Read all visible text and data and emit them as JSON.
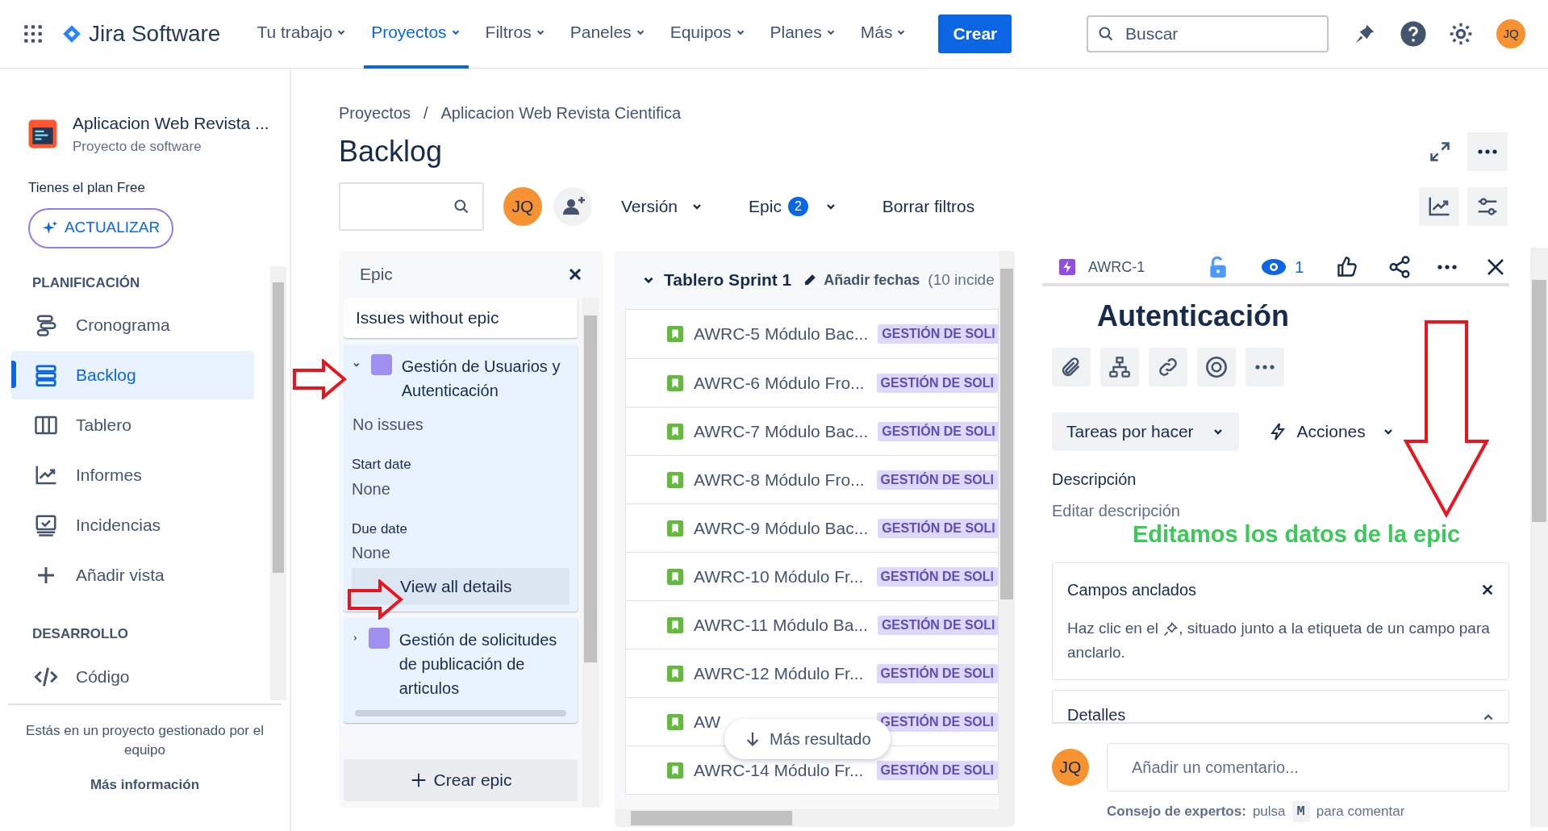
{
  "nav": {
    "logo": "Jira Software",
    "menu": [
      {
        "label": "Tu trabajo",
        "selected": false
      },
      {
        "label": "Proyectos",
        "selected": true
      },
      {
        "label": "Filtros",
        "selected": false
      },
      {
        "label": "Paneles",
        "selected": false
      },
      {
        "label": "Equipos",
        "selected": false
      },
      {
        "label": "Planes",
        "selected": false
      },
      {
        "label": "Más",
        "selected": false
      }
    ],
    "create": "Crear",
    "search": {
      "placeholder": "Buscar"
    },
    "avatar": "JQ"
  },
  "sidebar": {
    "project": {
      "name": "Aplicacion Web Revista ...",
      "type": "Proyecto de software"
    },
    "plan": "Tienes el plan Free",
    "upgrade": "ACTUALIZAR",
    "sections": [
      {
        "title": "PLANIFICACIÓN",
        "items": [
          {
            "label": "Cronograma",
            "selected": false
          },
          {
            "label": "Backlog",
            "selected": true
          },
          {
            "label": "Tablero",
            "selected": false
          },
          {
            "label": "Informes",
            "selected": false
          },
          {
            "label": "Incidencias",
            "selected": false
          },
          {
            "label": "Añadir vista",
            "selected": false
          }
        ]
      },
      {
        "title": "DESARROLLO",
        "items": [
          {
            "label": "Código",
            "selected": false
          }
        ]
      }
    ],
    "footer": "Estás en un proyecto gestionado por el equipo",
    "more": "Más información"
  },
  "main": {
    "breadcrumb": [
      "Proyectos",
      "Aplicacion Web Revista Cientifica"
    ],
    "breadcrumb_separator": "/",
    "title": "Backlog",
    "toolbar": {
      "avatar": "JQ",
      "version": "Versión",
      "epic": "Epic",
      "epic_count": "2",
      "clear": "Borrar filtros"
    }
  },
  "epic_panel": {
    "title": "Epic",
    "no_epic": "Issues without epic",
    "epics": [
      {
        "name": "Gestión de Usuarios y Autenticación",
        "color": "#9f8fef",
        "expanded": true,
        "issues": "No issues",
        "start_label": "Start date",
        "start": "None",
        "due_label": "Due date",
        "due": "None",
        "details": "View all details"
      },
      {
        "name": "Gestión de solicitudes de publicación de articulos",
        "color": "#9f8fef",
        "expanded": false
      }
    ],
    "create": "Crear epic"
  },
  "sprint": {
    "name": "Tablero Sprint 1",
    "add_dates": "Añadir fechas",
    "count": "(10 incide",
    "issues": [
      {
        "summary": "AWRC-5 Módulo Bac...",
        "tag": "GESTIÓN DE SOLI"
      },
      {
        "summary": "AWRC-6 Módulo Fro...",
        "tag": "GESTIÓN DE SOLI"
      },
      {
        "summary": "AWRC-7 Módulo Bac...",
        "tag": "GESTIÓN DE SOLI"
      },
      {
        "summary": "AWRC-8 Módulo Fro...",
        "tag": "GESTIÓN DE SOLI"
      },
      {
        "summary": "AWRC-9 Módulo Bac...",
        "tag": "GESTIÓN DE SOLI"
      },
      {
        "summary": "AWRC-10 Módulo Fr...",
        "tag": "GESTIÓN DE SOLI"
      },
      {
        "summary": "AWRC-11 Módulo Ba...",
        "tag": "GESTIÓN DE SOLI"
      },
      {
        "summary": "AWRC-12 Módulo Fr...",
        "tag": "GESTIÓN DE SOLI"
      },
      {
        "summary": "AW",
        "tag": "GESTIÓN DE SOLI"
      },
      {
        "summary": "AWRC-14 Módulo Fr...",
        "tag": "GESTIÓN DE SOLI"
      }
    ],
    "more": "Más resultado"
  },
  "detail": {
    "key": "AWRC-1",
    "watchers": "1",
    "title": "Autenticación",
    "status": "Tareas por hacer",
    "actions": "Acciones",
    "description_label": "Descripción",
    "description_placeholder": "Editar descripción",
    "pinned": {
      "title": "Campos anclados",
      "text_before": "Haz clic en el",
      "text_after": ", situado junto a la etiqueta de un campo para anclarlo."
    },
    "details_label": "Detalles",
    "comment": {
      "avatar": "JQ",
      "placeholder": "Añadir un comentario..."
    },
    "tip": {
      "label": "Consejo de expertos:",
      "before": "pulsa",
      "key": "M",
      "after": "para comentar"
    }
  },
  "annotation": "Editamos los datos de la epic"
}
